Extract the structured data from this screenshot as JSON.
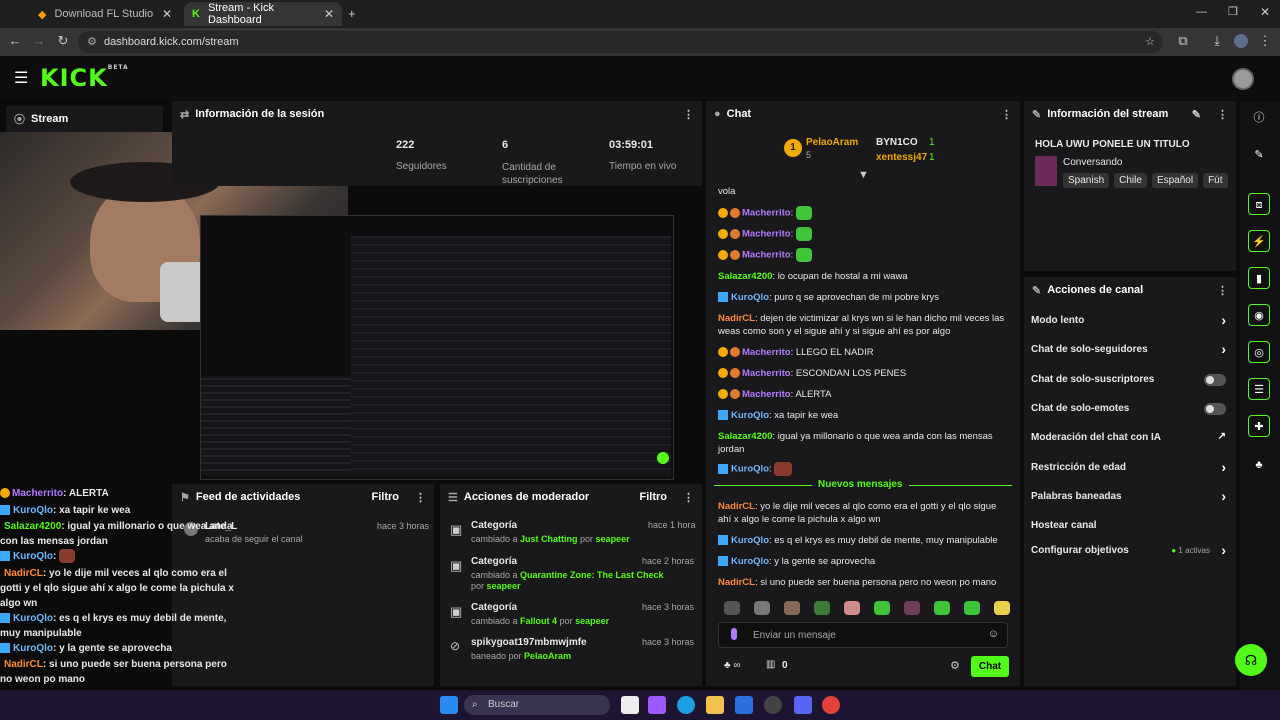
{
  "browser": {
    "tabs": [
      {
        "title": "Download FL Studio",
        "active": false
      },
      {
        "title": "Stream - Kick Dashboard",
        "active": true
      }
    ],
    "url": "dashboard.kick.com/stream"
  },
  "header": {
    "logo": "KICK",
    "logo_sup": "BETA"
  },
  "stream_panel": {
    "title": "Stream"
  },
  "session": {
    "title": "Información de la sesión",
    "stats": [
      {
        "value": "222",
        "label": "Seguidores"
      },
      {
        "value": "6",
        "label": "Cantidad de suscripciones"
      },
      {
        "value": "03:59:01",
        "label": "Tiempo en vivo"
      }
    ]
  },
  "chat": {
    "title": "Chat",
    "top": {
      "rank1_name": "PelaoAram",
      "rank1_count": "5",
      "right1_name": "BYN1CO",
      "right1_count": "1",
      "right2_name": "xentessj47",
      "right2_count": "1"
    },
    "messages": [
      {
        "user": "",
        "text": "vola",
        "color": ""
      },
      {
        "user": "Macherrito",
        "text": ":",
        "color": "purple",
        "emote": true
      },
      {
        "user": "Macherrito",
        "text": ":",
        "color": "purple",
        "emote": true
      },
      {
        "user": "Macherrito",
        "text": ":",
        "color": "purple",
        "emote": true
      },
      {
        "user": "Salazar4200",
        "text": ": lo ocupan de hostal a mi wawa",
        "color": "green"
      },
      {
        "user": "KuroQlo",
        "text": ": puro q se aprovechan de mi pobre krys",
        "color": "blue"
      },
      {
        "user": "NadirCL",
        "text": ": dejen de victimizar al krys wn si le han dicho mil veces las weas como son y el sigue ahí y si sigue ahí es por algo",
        "color": "orange"
      },
      {
        "user": "Macherrito",
        "text": ": LLEGO EL NADIR",
        "color": "purple"
      },
      {
        "user": "Macherrito",
        "text": ": ESCONDAN LOS PENES",
        "color": "purple"
      },
      {
        "user": "Macherrito",
        "text": ": ALERTA",
        "color": "purple"
      },
      {
        "user": "KuroQlo",
        "text": ": xa tapir ke wea",
        "color": "blue"
      },
      {
        "user": "Salazar4200",
        "text": ": igual ya millonario o que wea anda con las mensas jordan",
        "color": "green"
      },
      {
        "user": "KuroQlo",
        "text": ":",
        "color": "blue",
        "emote": true
      }
    ],
    "new_messages_label": "Nuevos mensajes",
    "new_messages": [
      {
        "user": "NadirCL",
        "text": ": yo le dije mil veces al qlo como era el gotti y el qlo sigue ahí x algo le come la pichula x algo wn",
        "color": "orange"
      },
      {
        "user": "KuroQlo",
        "text": ": es q el krys es muy debil de mente, muy manipulable",
        "color": "blue"
      },
      {
        "user": "KuroQlo",
        "text": ": y la gente se aprovecha",
        "color": "blue"
      },
      {
        "user": "NadirCL",
        "text": ": si uno puede ser buena persona pero no weon po mano",
        "color": "orange"
      }
    ],
    "input_placeholder": "Enviar un mensaje",
    "count": "0",
    "send_label": "Chat"
  },
  "stream_info": {
    "title": "Información del stream",
    "stream_title": "HOLA UWU PONELE UN TITULO",
    "category": "Conversando",
    "tags": [
      "Spanish",
      "Chile",
      "Español",
      "Fút"
    ]
  },
  "channel_actions": {
    "title": "Acciones de canal",
    "items": [
      {
        "label": "Modo lento",
        "control": "arrow"
      },
      {
        "label": "Chat de solo-seguidores",
        "control": "arrow"
      },
      {
        "label": "Chat de solo-suscriptores",
        "control": "toggle"
      },
      {
        "label": "Chat de solo-emotes",
        "control": "toggle"
      },
      {
        "label": "Moderación del chat con IA",
        "control": "link"
      },
      {
        "label": "Restricción de edad",
        "control": "arrow"
      },
      {
        "label": "Palabras baneadas",
        "control": "arrow"
      },
      {
        "label": "Hostear canal",
        "control": "none"
      },
      {
        "label": "Configurar objetivos",
        "control": "arrow",
        "extra": "1 activas"
      }
    ]
  },
  "activity": {
    "title": "Feed de actividades",
    "filter": "Filtro",
    "items": [
      {
        "user": "Late_L",
        "text": "acaba de seguir el canal",
        "time": "hace 3 horas"
      }
    ]
  },
  "moderator": {
    "title": "Acciones de moderador",
    "filter": "Filtro",
    "items": [
      {
        "title": "Categoría",
        "pre": "cambiado a ",
        "target": "Just Chatting",
        "mid": " por ",
        "by": "seapeer",
        "time": "hace 1 hora"
      },
      {
        "title": "Categoría",
        "pre": "cambiado a ",
        "target": "Quarantine Zone: The Last Check",
        "mid": " por ",
        "by": "seapeer",
        "time": "hace 2 horas"
      },
      {
        "title": "Categoría",
        "pre": "cambiado a ",
        "target": "Fallout 4",
        "mid": " por ",
        "by": "seapeer",
        "time": "hace 3 horas"
      },
      {
        "title": "spikygoat197mbmwjmfe",
        "pre": "baneado por ",
        "target": "",
        "mid": "",
        "by": "PelaoAram",
        "time": "hace 3 horas"
      }
    ]
  },
  "overlay_chat": [
    {
      "user": "Macherrito",
      "text": ": ALERTA",
      "color": "purple"
    },
    {
      "user": "KuroQlo",
      "text": ": xa tapir ke wea",
      "color": "blue"
    },
    {
      "user": "Salazar4200",
      "text": ": igual ya millonario o que wea anda con las mensas jordan",
      "color": "green"
    },
    {
      "user": "KuroQlo",
      "text": ":",
      "color": "blue"
    },
    {
      "user": "NadirCL",
      "text": ": yo le dije mil veces al qlo como era el gotti y el qlo sigue ahí x algo le come la pichula x algo wn",
      "color": "orange"
    },
    {
      "user": "KuroQlo",
      "text": ": es q el krys es muy debil de mente, muy manipulable",
      "color": "blue"
    },
    {
      "user": "KuroQlo",
      "text": ": y la gente se aprovecha",
      "color": "blue"
    },
    {
      "user": "NadirCL",
      "text": ": si uno puede ser buena persona pero no weon po mano",
      "color": "orange"
    }
  ],
  "taskbar": {
    "search_placeholder": "Buscar"
  },
  "colors": {
    "accent": "#53fc18",
    "panel": "#19191b",
    "bg": "#0b0b0c"
  }
}
